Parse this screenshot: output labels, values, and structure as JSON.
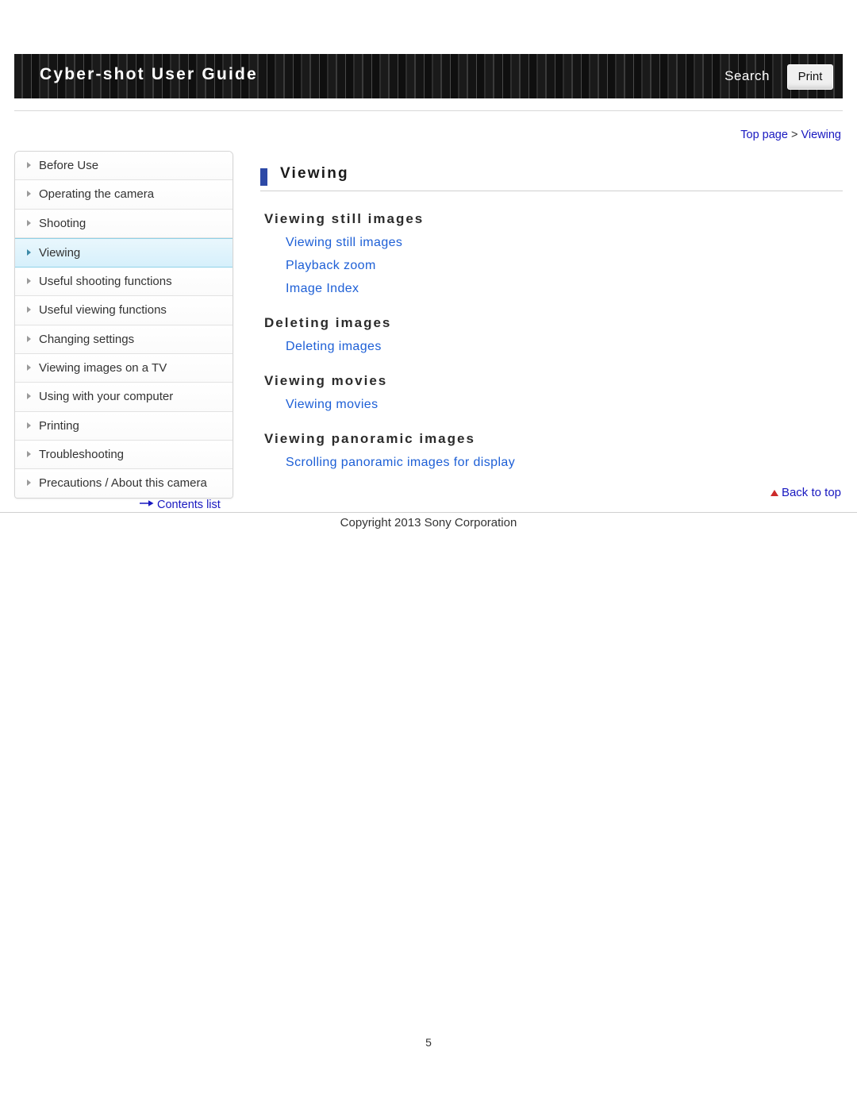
{
  "header": {
    "title": "Cyber-shot User Guide",
    "search_label": "Search",
    "print_label": "Print"
  },
  "breadcrumb": {
    "top": "Top page",
    "separator": ">",
    "current": "Viewing"
  },
  "sidebar": {
    "items": [
      {
        "label": "Before Use",
        "active": false
      },
      {
        "label": "Operating the camera",
        "active": false
      },
      {
        "label": "Shooting",
        "active": false
      },
      {
        "label": "Viewing",
        "active": true
      },
      {
        "label": "Useful shooting functions",
        "active": false
      },
      {
        "label": "Useful viewing functions",
        "active": false
      },
      {
        "label": "Changing settings",
        "active": false
      },
      {
        "label": "Viewing images on a TV",
        "active": false
      },
      {
        "label": "Using with your computer",
        "active": false
      },
      {
        "label": "Printing",
        "active": false
      },
      {
        "label": "Troubleshooting",
        "active": false
      },
      {
        "label": "Precautions / About this camera",
        "active": false
      }
    ],
    "contents_list_label": "Contents list"
  },
  "main": {
    "page_title": "Viewing",
    "sections": [
      {
        "heading": "Viewing still images",
        "links": [
          "Viewing still images",
          "Playback zoom",
          "Image Index"
        ]
      },
      {
        "heading": "Deleting images",
        "links": [
          "Deleting images"
        ]
      },
      {
        "heading": "Viewing movies",
        "links": [
          "Viewing movies"
        ]
      },
      {
        "heading": "Viewing panoramic images",
        "links": [
          "Scrolling panoramic images for display"
        ]
      }
    ],
    "back_to_top_label": "Back to top"
  },
  "footer": {
    "copyright": "Copyright 2013 Sony Corporation",
    "page_number": "5"
  }
}
